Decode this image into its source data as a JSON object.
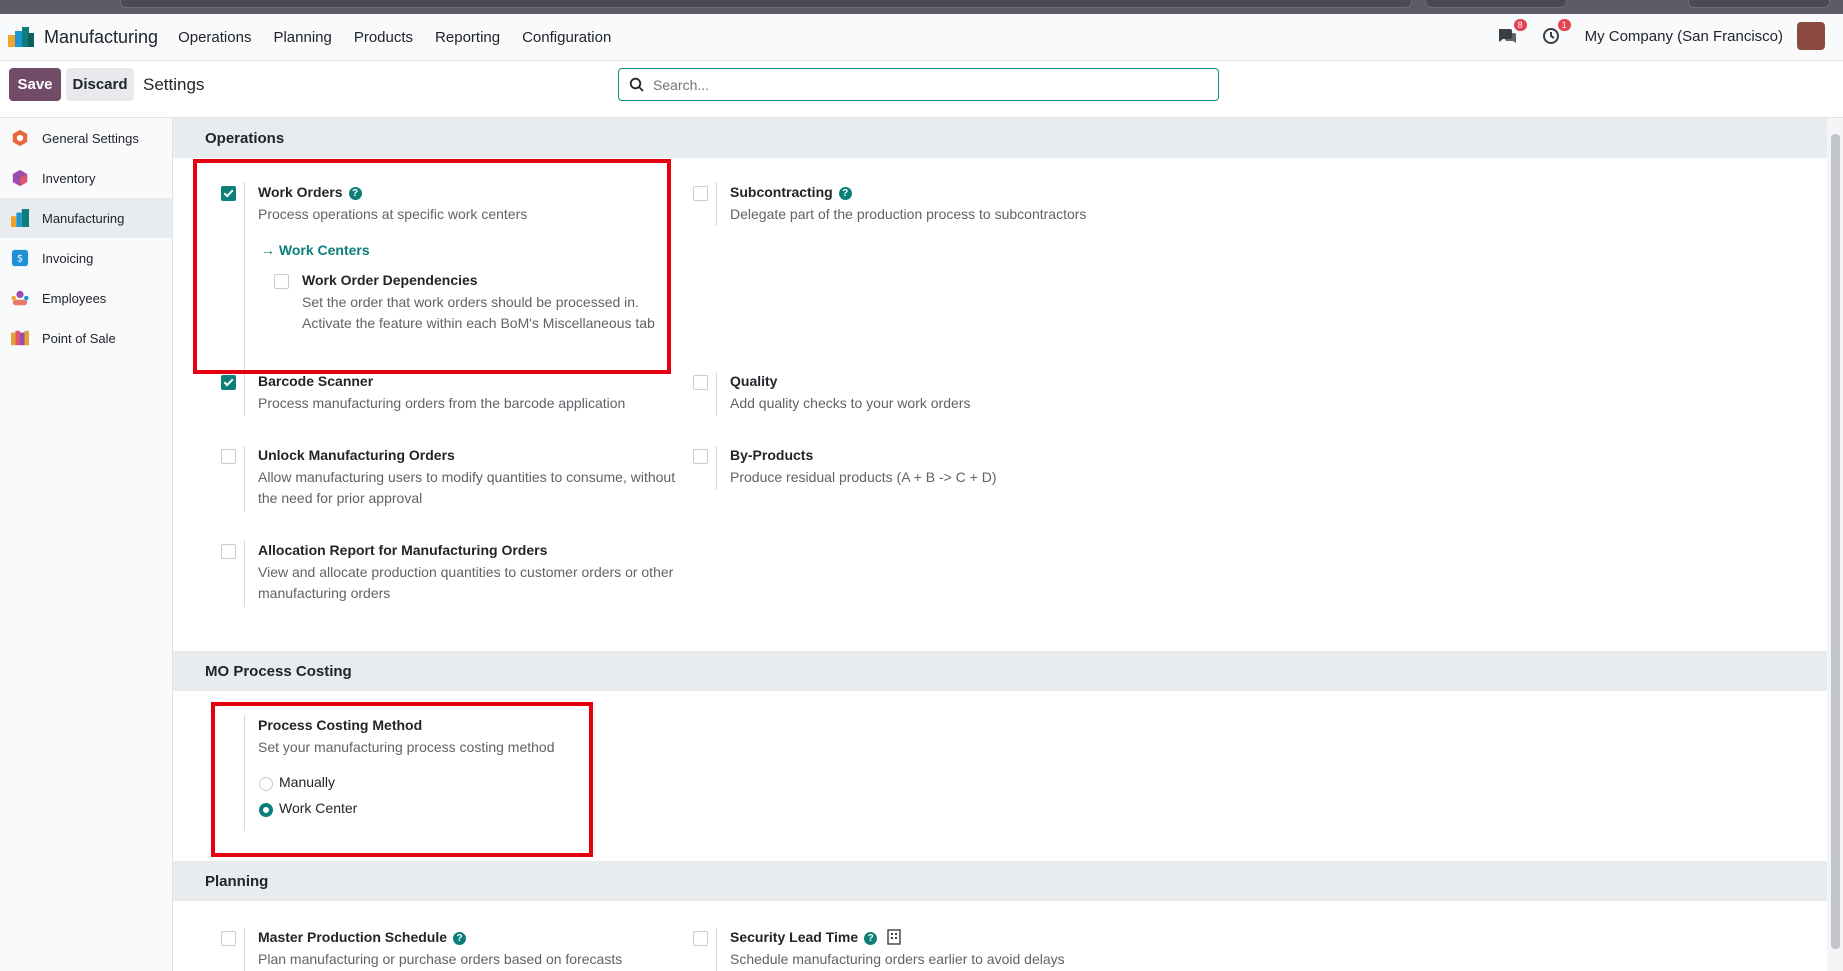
{
  "navbar": {
    "app_name": "Manufacturing",
    "menu": [
      "Operations",
      "Planning",
      "Products",
      "Reporting",
      "Configuration"
    ],
    "messages_count": "8",
    "activities_count": "1",
    "company": "My Company (San Francisco)"
  },
  "control": {
    "save_label": "Save",
    "discard_label": "Discard",
    "title": "Settings",
    "search_placeholder": "Search..."
  },
  "sidebar": {
    "items": [
      {
        "label": "General Settings",
        "icon": "general-settings-icon",
        "color": "#e8663b"
      },
      {
        "label": "Inventory",
        "icon": "inventory-icon",
        "color": "#9b4dae"
      },
      {
        "label": "Manufacturing",
        "icon": "manufacturing-icon",
        "color": "#0d7e7a"
      },
      {
        "label": "Invoicing",
        "icon": "invoicing-icon",
        "color": "#1f8fd6"
      },
      {
        "label": "Employees",
        "icon": "employees-icon",
        "color": "#e47b6b"
      },
      {
        "label": "Point of Sale",
        "icon": "point-of-sale-icon",
        "color": "#e4a13a"
      }
    ],
    "active": "Manufacturing"
  },
  "sections": {
    "operations": {
      "title": "Operations",
      "work_orders": {
        "title": "Work Orders",
        "desc": "Process operations at specific work centers",
        "checked": true
      },
      "work_centers_link": "Work Centers",
      "wo_dependencies": {
        "title": "Work Order Dependencies",
        "desc": "Set the order that work orders should be processed in. Activate the feature within each BoM's Miscellaneous tab",
        "checked": false
      },
      "subcontracting": {
        "title": "Subcontracting",
        "desc": "Delegate part of the production process to subcontractors",
        "checked": false
      },
      "barcode": {
        "title": "Barcode Scanner",
        "desc": "Process manufacturing orders from the barcode application",
        "checked": true
      },
      "quality": {
        "title": "Quality",
        "desc": "Add quality checks to your work orders",
        "checked": false
      },
      "unlock": {
        "title": "Unlock Manufacturing Orders",
        "desc": "Allow manufacturing users to modify quantities to consume, without the need for prior approval",
        "checked": false
      },
      "byproducts": {
        "title": "By-Products",
        "desc": "Produce residual products (A + B -> C + D)",
        "checked": false
      },
      "allocation": {
        "title": "Allocation Report for Manufacturing Orders",
        "desc": "View and allocate production quantities to customer orders or other manufacturing orders",
        "checked": false
      }
    },
    "costing": {
      "title": "MO Process Costing",
      "method": {
        "title": "Process Costing Method",
        "desc": "Set your manufacturing process costing method"
      },
      "options": [
        "Manually",
        "Work Center"
      ],
      "selected": "Work Center"
    },
    "planning": {
      "title": "Planning",
      "mps": {
        "title": "Master Production Schedule",
        "desc": "Plan manufacturing or purchase orders based on forecasts",
        "checked": false
      },
      "lead_time": {
        "title": "Security Lead Time",
        "desc": "Schedule manufacturing orders earlier to avoid delays",
        "checked": false
      }
    }
  },
  "colors": {
    "brand": "#714b67",
    "accent": "#0d7e7a",
    "highlight": "#e3000f"
  }
}
